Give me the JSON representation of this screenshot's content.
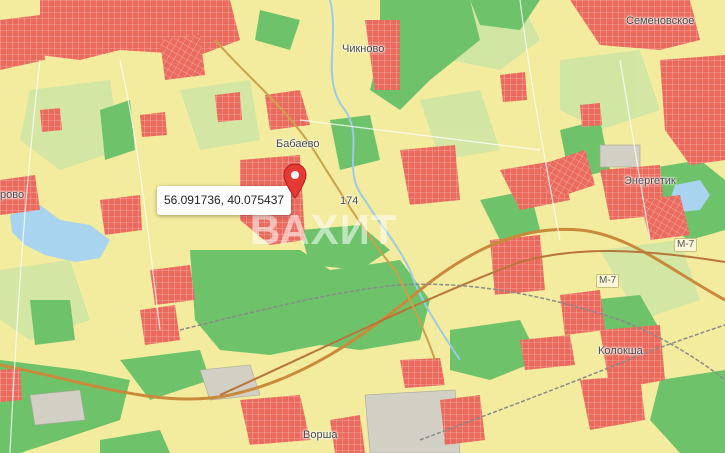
{
  "map": {
    "colors": {
      "background": "#f3eb9d",
      "forest": "#6ec36a",
      "forest_light": "#a9d98f",
      "settlement": "#ea6a5d",
      "settlement_grid": "#ffffff",
      "water": "#a8d4ef",
      "highway": "#c98a3c",
      "railway": "#8a8a8a",
      "industrial": "#e7b0a8",
      "gray_zone": "#d2cfc5",
      "marker": "#e53935"
    },
    "places": {
      "semenovskoe": "Семеновское",
      "chiknikovo": "Чикново",
      "babaevo": "Бабаево",
      "energetik": "Энергетик",
      "kolokshа": "Колокша",
      "vorsha": "Ворша",
      "left_edge": "рово",
      "lanovo_fragment": "174"
    },
    "roads": {
      "m7": "М-7",
      "m7_b": "М-7"
    },
    "marker": {
      "coordinates": "56.091736, 40.075437",
      "icon": "map-pin-icon"
    },
    "watermark": "ВАХИТ"
  }
}
